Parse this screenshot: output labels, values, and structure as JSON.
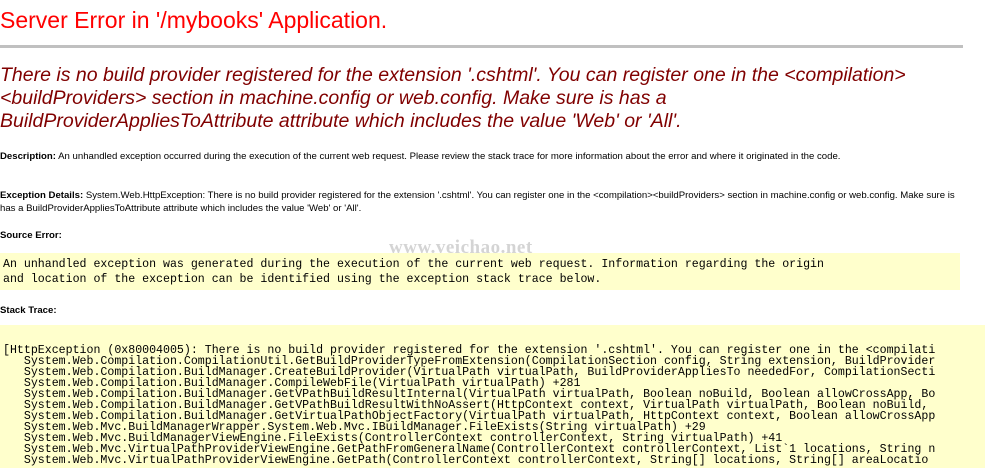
{
  "title": "Server Error in '/mybooks' Application.",
  "subtitle": "There is no build provider registered for the extension '.cshtml'. You can register one in the <compilation><buildProviders> section in machine.config or web.config. Make sure is has a BuildProviderAppliesToAttribute attribute which includes the value 'Web' or 'All'.",
  "description": {
    "label": "Description:",
    "text": "An unhandled exception occurred during the execution of the current web request. Please review the stack trace for more information about the error and where it originated in the code."
  },
  "exception_details": {
    "label": "Exception Details:",
    "text": "System.Web.HttpException: There is no build provider registered for the extension '.cshtml'. You can register one in the <compilation><buildProviders> section in machine.config or web.config. Make sure is has a BuildProviderAppliesToAttribute attribute which includes the value 'Web' or 'All'."
  },
  "source_error": {
    "label": "Source Error:",
    "lines": [
      "An unhandled exception was generated during the execution of the current web request. Information regarding the origin",
      "and location of the exception can be identified using the exception stack trace below."
    ]
  },
  "watermark": "www.veichao.net",
  "stack_trace": {
    "label": "Stack Trace:",
    "lines": [
      "[HttpException (0x80004005): There is no build provider registered for the extension '.cshtml'. You can register one in the <compilati",
      "   System.Web.Compilation.CompilationUtil.GetBuildProviderTypeFromExtension(CompilationSection config, String extension, BuildProvider",
      "   System.Web.Compilation.BuildManager.CreateBuildProvider(VirtualPath virtualPath, BuildProviderAppliesTo neededFor, CompilationSecti",
      "   System.Web.Compilation.BuildManager.CompileWebFile(VirtualPath virtualPath) +281",
      "   System.Web.Compilation.BuildManager.GetVPathBuildResultInternal(VirtualPath virtualPath, Boolean noBuild, Boolean allowCrossApp, Bo",
      "   System.Web.Compilation.BuildManager.GetVPathBuildResultWithNoAssert(HttpContext context, VirtualPath virtualPath, Boolean noBuild, ",
      "   System.Web.Compilation.BuildManager.GetVirtualPathObjectFactory(VirtualPath virtualPath, HttpContext context, Boolean allowCrossApp",
      "   System.Web.Mvc.BuildManagerWrapper.System.Web.Mvc.IBuildManager.FileExists(String virtualPath) +29",
      "   System.Web.Mvc.BuildManagerViewEngine.FileExists(ControllerContext controllerContext, String virtualPath) +41",
      "   System.Web.Mvc.VirtualPathProviderViewEngine.GetPathFromGeneralName(ControllerContext controllerContext, List`1 locations, String n",
      "   System.Web.Mvc.VirtualPathProviderViewEngine.GetPath(ControllerContext controllerContext, String[] locations, String[] areaLocatio"
    ]
  }
}
